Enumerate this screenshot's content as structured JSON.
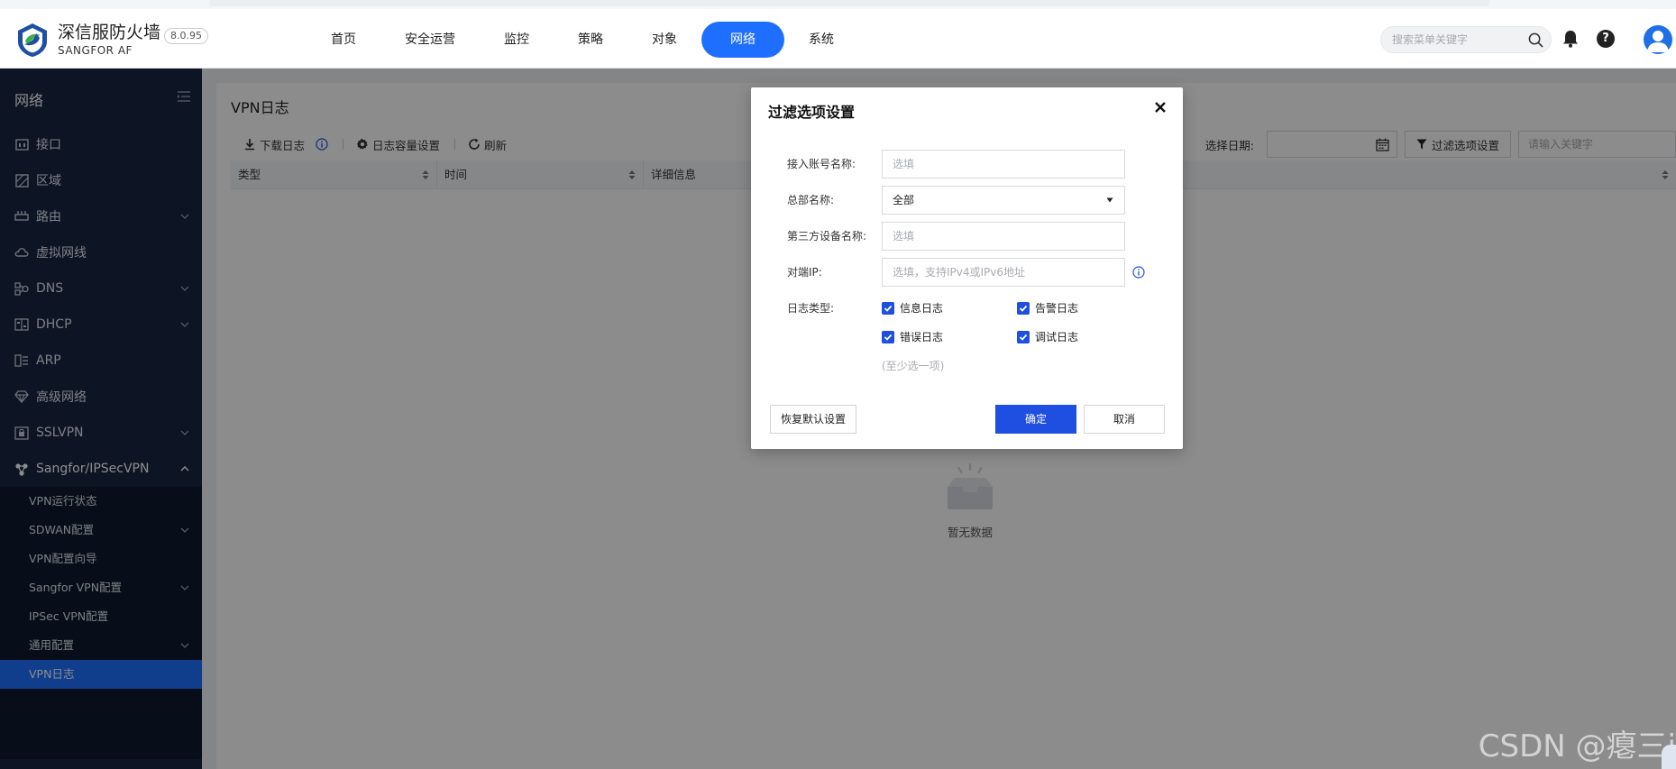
{
  "brand": {
    "name": "深信服防火墙",
    "sub": "SANGFOR AF",
    "version": "8.0.95"
  },
  "nav": {
    "items": [
      "首页",
      "安全运营",
      "监控",
      "策略",
      "对象",
      "网络",
      "系统"
    ],
    "active": "网络"
  },
  "search": {
    "placeholder": "搜索菜单关键字"
  },
  "sidebar": {
    "title": "网络",
    "items": [
      {
        "label": "接口",
        "icon": "interface-icon"
      },
      {
        "label": "区域",
        "icon": "zone-icon"
      },
      {
        "label": "路由",
        "icon": "route-icon",
        "expandable": true
      },
      {
        "label": "虚拟网线",
        "icon": "cloud-icon"
      },
      {
        "label": "DNS",
        "icon": "dns-icon",
        "expandable": true
      },
      {
        "label": "DHCP",
        "icon": "dhcp-icon",
        "expandable": true
      },
      {
        "label": "ARP",
        "icon": "arp-icon"
      },
      {
        "label": "高级网络",
        "icon": "diamond-icon"
      },
      {
        "label": "SSLVPN",
        "icon": "sslvpn-icon",
        "expandable": true
      },
      {
        "label": "Sangfor/IPSecVPN",
        "icon": "vpn-icon",
        "expandable": true,
        "open": true
      }
    ],
    "sub_items": [
      {
        "label": "VPN运行状态"
      },
      {
        "label": "SDWAN配置",
        "expandable": true
      },
      {
        "label": "VPN配置向导"
      },
      {
        "label": "Sangfor VPN配置",
        "expandable": true
      },
      {
        "label": "IPSec VPN配置"
      },
      {
        "label": "通用配置",
        "expandable": true
      },
      {
        "label": "VPN日志",
        "active": true
      }
    ]
  },
  "panel": {
    "title": "VPN日志",
    "toolbar": {
      "download": "下载日志",
      "capacity": "日志容量设置",
      "refresh": "刷新",
      "date_label": "选择日期:",
      "filter": "过滤选项设置",
      "keyword_placeholder": "请输入关键字"
    },
    "columns": [
      "类型",
      "时间",
      "详细信息"
    ],
    "empty_text": "暂无数据"
  },
  "modal": {
    "title": "过滤选项设置",
    "fields": {
      "account_label": "接入账号名称:",
      "account_placeholder": "选填",
      "hq_label": "总部名称:",
      "hq_value": "全部",
      "third_label": "第三方设备名称:",
      "third_placeholder": "选填",
      "peer_label": "对端IP:",
      "peer_placeholder": "选填，支持IPv4或IPv6地址",
      "logtype_label": "日志类型:"
    },
    "checkboxes": [
      "信息日志",
      "告警日志",
      "错误日志",
      "调试日志"
    ],
    "hint": "(至少选一项)",
    "buttons": {
      "reset": "恢复默认设置",
      "ok": "确定",
      "cancel": "取消"
    }
  },
  "watermark": "CSDN @瘪三i",
  "colors": {
    "primary": "#1e6fff",
    "sidebar_bg": "#182642",
    "sidebar_sub_bg": "#101a2f",
    "modal_primary": "#1e4fe0"
  }
}
